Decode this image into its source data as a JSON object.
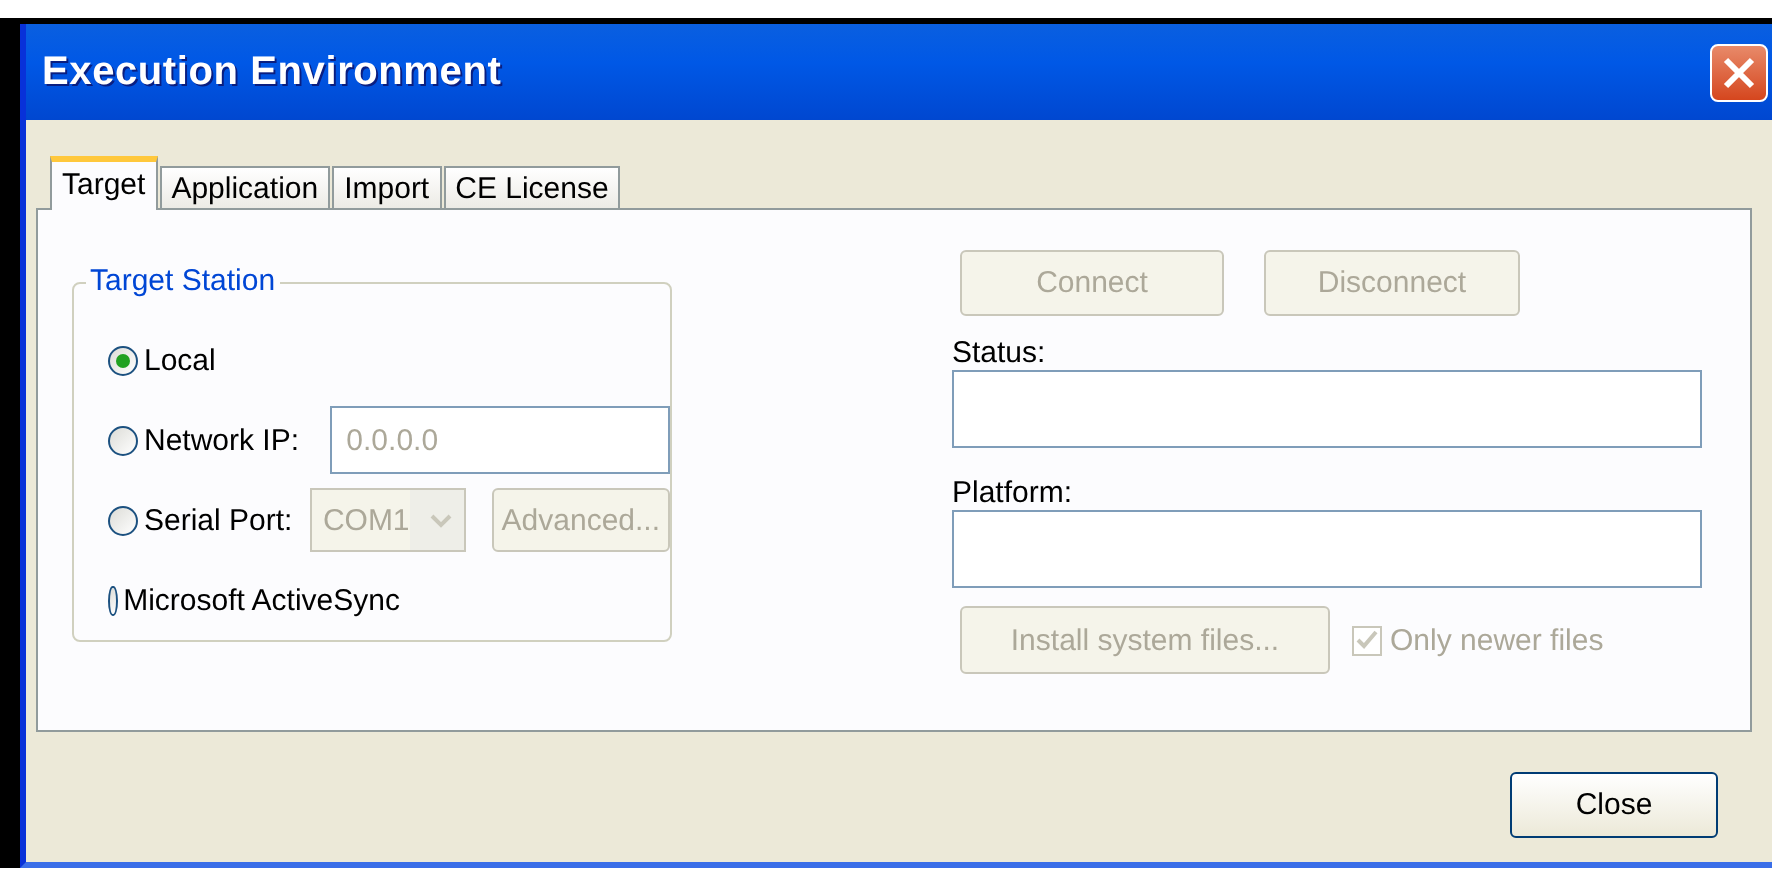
{
  "window": {
    "title": "Execution Environment"
  },
  "tabs": [
    {
      "label": "Target",
      "selected": true
    },
    {
      "label": "Application",
      "selected": false
    },
    {
      "label": "Import",
      "selected": false
    },
    {
      "label": "CE License",
      "selected": false
    }
  ],
  "target_station": {
    "title": "Target Station",
    "options": [
      {
        "label": "Local",
        "selected": true
      },
      {
        "label": "Network IP:",
        "selected": false,
        "field": {
          "value": "0.0.0.0",
          "disabled": true
        }
      },
      {
        "label": "Serial Port:",
        "selected": false,
        "combo": {
          "value": "COM1",
          "disabled": true
        },
        "button": {
          "label": "Advanced...",
          "disabled": true
        }
      },
      {
        "label": "Microsoft ActiveSync",
        "selected": false
      }
    ]
  },
  "connection": {
    "buttons": [
      {
        "label": "Connect",
        "disabled": true
      },
      {
        "label": "Disconnect",
        "disabled": true
      }
    ],
    "fields": [
      {
        "label": "Status:"
      },
      {
        "label": "Platform:"
      }
    ],
    "install_button": {
      "label": "Install system files...",
      "disabled": true
    },
    "only_newer": {
      "label": "Only newer files",
      "checked": true,
      "disabled": true
    }
  },
  "close_button": {
    "label": "Close"
  }
}
